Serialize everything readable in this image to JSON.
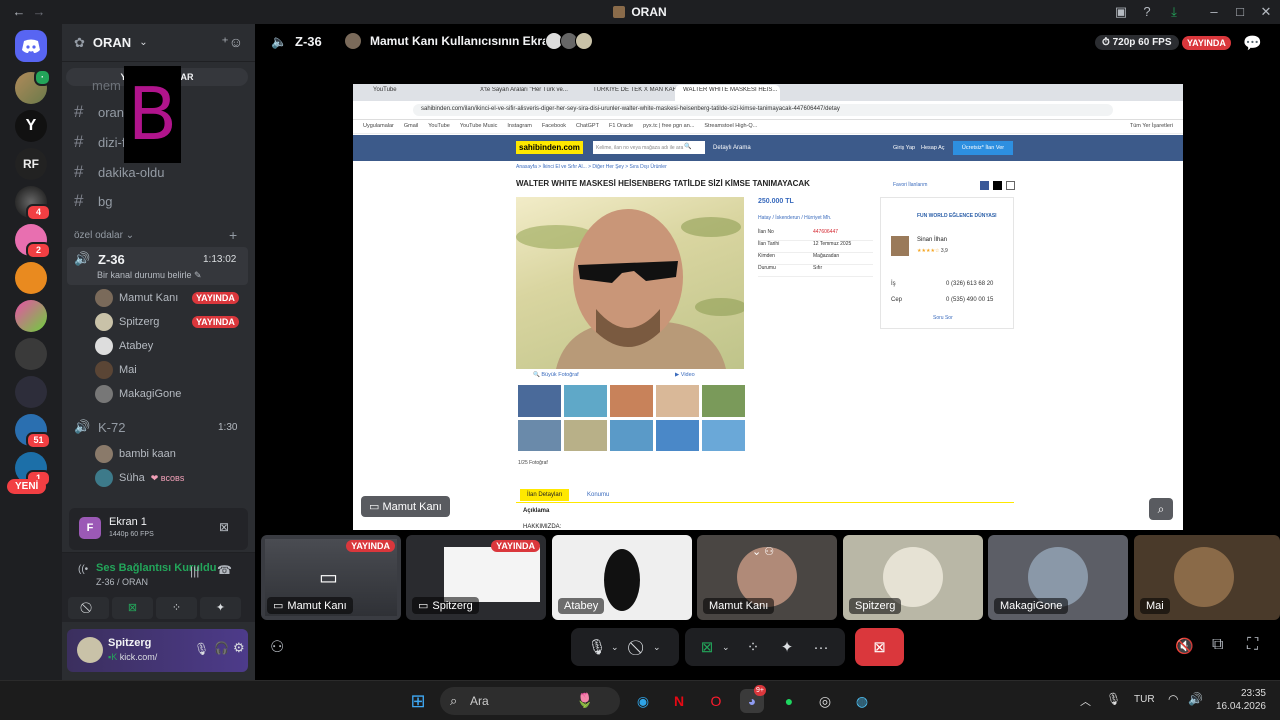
{
  "window": {
    "title": "ORAN",
    "back": "←",
    "fwd": "→"
  },
  "server": {
    "name": "ORAN",
    "new_messages_banner": "YENİ MESAJLAR",
    "new_label": "YENİ"
  },
  "channels": [
    {
      "name": "mem"
    },
    {
      "name": "oran-...y"
    },
    {
      "name": "dizi-f..."
    },
    {
      "name": "dakika-oldu"
    },
    {
      "name": "bg"
    }
  ],
  "category": {
    "label": "özel odalar",
    "add": "+"
  },
  "voice1": {
    "name": "Z-36",
    "timer": "1:13:02",
    "status": "Bir kanal durumu belirle",
    "users": [
      {
        "name": "Mamut Kanı",
        "live": "YAYINDA"
      },
      {
        "name": "Spitzerg",
        "live": "YAYINDA"
      },
      {
        "name": "Atabey",
        "live": ""
      },
      {
        "name": "Mai",
        "live": ""
      },
      {
        "name": "MakagiGone",
        "live": ""
      }
    ]
  },
  "voice2": {
    "name": "K-72",
    "timer": "1:30",
    "users": [
      {
        "name": "bambi kaan"
      },
      {
        "name": "Süha",
        "tag": "ʙᴄᴏʙs"
      }
    ]
  },
  "server_badges": [
    "4",
    "2",
    "51",
    "1"
  ],
  "screen_panel": {
    "title": "Ekran 1",
    "quality": "1440p 60 FPS"
  },
  "connection": {
    "status": "Ses Bağlantısı Kuruldu",
    "channel": "Z-36 / ORAN"
  },
  "me": {
    "name": "Spitzerg",
    "status": "kick.com/"
  },
  "header": {
    "channel": "Z-36",
    "stream_title": "Mamut Kanı Kullanıcısının Ekranı",
    "quality": "720p 60 FPS",
    "live": "YAYINDA"
  },
  "share": {
    "tabs": [
      "YouTube",
      "X'te Sayan Araları \"Her Türk ve...",
      "TÜRKİYE DE TEK X MAN KARAKT...",
      "WALTER WHITE MASKESİ HEİS..."
    ],
    "url": "sahibinden.com/ilan/ikinci-el-ve-sifir-alisveris-diger-her-sey-sira-disi-urunler-walter-white-maskesi-heisenberg-tatilde-sizi-kimse-tanimayacak-447606447/detay",
    "bookmarks": [
      "Uygulamalar",
      "Gmail",
      "YouTube",
      "YouTube Music",
      "Instagram",
      "Facebook",
      "ChatGPT",
      "F1 Oracle",
      "pyx.tc | free pgn an...",
      "Streamstoel High-Q...",
      "Tüm Yer İşaretleri"
    ],
    "site_logo": "sahibinden.com",
    "search_ph": "Kelime, ilan no veya mağaza adı ile ara",
    "detailed_search": "Detaylı Arama",
    "login": "Giriş Yap",
    "register": "Hesap Aç",
    "post_ad": "Ücretsiz* İlan Ver",
    "breadcrumb": "Anasayfa > İkinci El ve Sıfır Al... > Diğer Her Şey > Sıra Dışı Ürünler",
    "listing_title": "WALTER WHITE MASKESİ HEİSENBERG TATİLDE SİZİ KİMSE TANIMAYACAK",
    "fav": "Favori İlanlarım",
    "price": "250.000 TL",
    "location": "Hatay / İskenderun / Hürriyet Mh.",
    "rows": [
      [
        "İlan No",
        "447606447"
      ],
      [
        "İlan Tarihi",
        "12 Temmuz 2025"
      ],
      [
        "Kimden",
        "Mağazadan"
      ],
      [
        "Durumu",
        "Sıfır"
      ]
    ],
    "store": "FUN WORLD EĞLENCE DÜNYASI",
    "seller": "Sinan İlhan",
    "rating": "3,9",
    "phones": [
      [
        "İş",
        "0 (326) 613 68 20"
      ],
      [
        "Cep",
        "0 (535) 490 00 15"
      ]
    ],
    "ask": "Soru Sor",
    "big_photo": "Büyük Fotoğraf",
    "video": "Video",
    "photo_count": "1/25 Fotoğraf",
    "tab_details": "İlan Detayları",
    "tab_location": "Konumu",
    "section": "Açıklama",
    "about": "HAKKIMIZDA:",
    "presenter": "Mamut Kanı"
  },
  "tiles": [
    {
      "name": "Mamut Kanı",
      "live": "YAYINDA"
    },
    {
      "name": "Spitzerg",
      "live": "YAYINDA"
    },
    {
      "name": "Atabey",
      "live": ""
    },
    {
      "name": "Mamut Kanı",
      "live": ""
    },
    {
      "name": "Spitzerg",
      "live": ""
    },
    {
      "name": "MakagiGone",
      "live": ""
    },
    {
      "name": "Mai",
      "live": ""
    }
  ],
  "taskbar": {
    "search": "Ara",
    "lang": "TUR",
    "time": "23:35",
    "date": "16.04.2026",
    "discord_badge": "9+"
  },
  "colors": {
    "live": "#da373c",
    "accent": "#5865f2",
    "leave": "#da373c",
    "green": "#23a55a"
  }
}
